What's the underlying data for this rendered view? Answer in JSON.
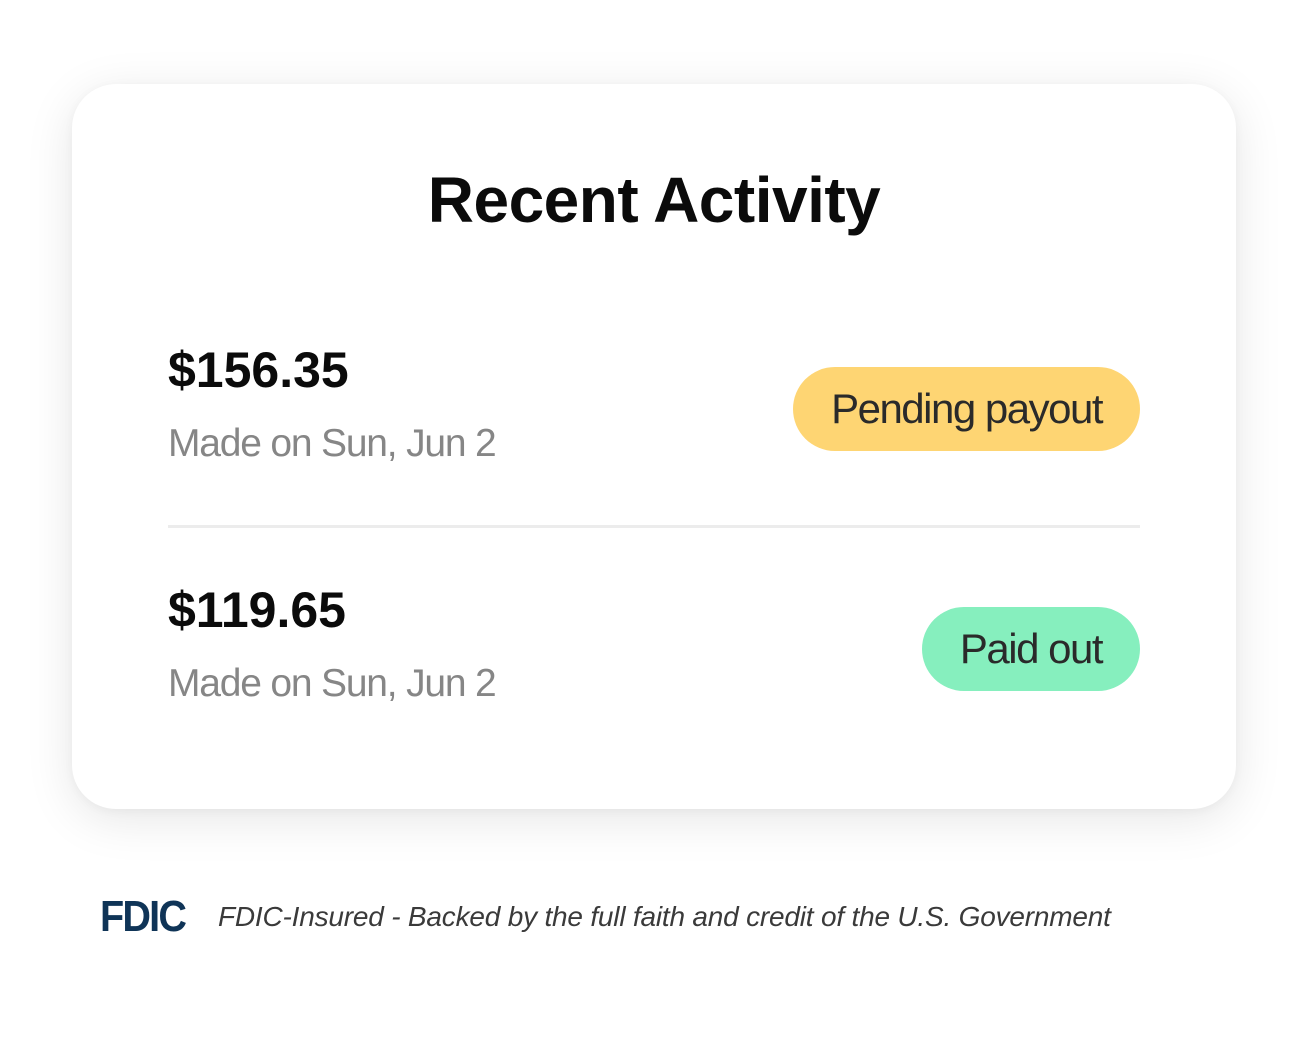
{
  "card": {
    "title": "Recent Activity",
    "transactions": [
      {
        "amount": "$156.35",
        "date": "Made on Sun, Jun 2",
        "status": "Pending payout",
        "status_color": "#fed573"
      },
      {
        "amount": "$119.65",
        "date": "Made on Sun, Jun 2",
        "status": "Paid out",
        "status_color": "#86efbe"
      }
    ]
  },
  "footer": {
    "logo": "FDIC",
    "text": "FDIC-Insured - Backed by the full faith and credit of the U.S. Government"
  },
  "colors": {
    "logo": "#0f3457",
    "secondary_text": "#868686"
  }
}
